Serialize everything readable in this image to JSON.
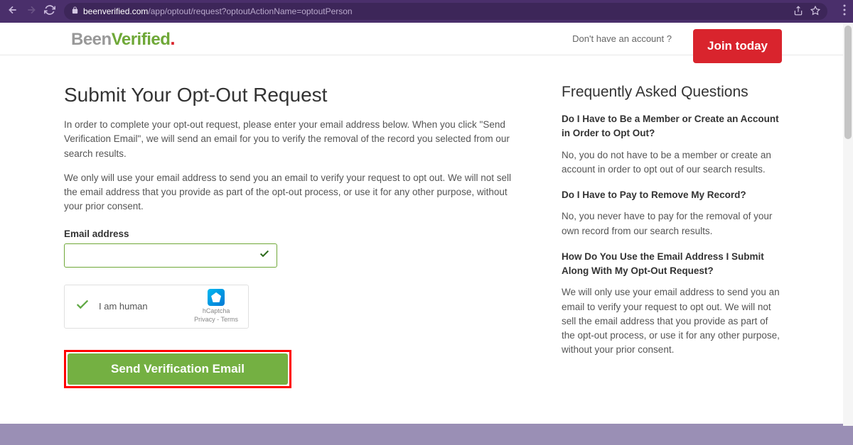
{
  "browser": {
    "url_prefix": "beenverified.com",
    "url_path": "/app/optout/request?optoutActionName=optoutPerson"
  },
  "header": {
    "logo_been": "Been",
    "logo_verified": "Verified",
    "logo_dot": ".",
    "account_text": "Don't have an account ?",
    "join_label": "Join today"
  },
  "main": {
    "title": "Submit Your Opt-Out Request",
    "p1": "In order to complete your opt-out request, please enter your email address below. When you click \"Send Verification Email\", we will send an email for you to verify the removal of the record you selected from our search results.",
    "p2": "We only will use your email address to send you an email to verify your request to opt out. We will not sell the email address that you provide as part of the opt-out process, or use it for any other purpose, without your prior consent.",
    "email_label": "Email address",
    "email_value": "",
    "captcha_text": "I am human",
    "captcha_brand": "hCaptcha",
    "captcha_links": "Privacy - Terms",
    "send_label": "Send Verification Email"
  },
  "faq": {
    "title": "Frequently Asked Questions",
    "items": [
      {
        "q": "Do I Have to Be a Member or Create an Account in Order to Opt Out?",
        "a": "No, you do not have to be a member or create an account in order to opt out of our search results."
      },
      {
        "q": "Do I Have to Pay to Remove My Record?",
        "a": "No, you never have to pay for the removal of your own record from our search results."
      },
      {
        "q": "How Do You Use the Email Address I Submit Along With My Opt-Out Request?",
        "a": "We will only use your email address to send you an email to verify your request to opt out. We will not sell the email address that you provide as part of the opt-out process, or use it for any other purpose, without your prior consent."
      }
    ]
  }
}
